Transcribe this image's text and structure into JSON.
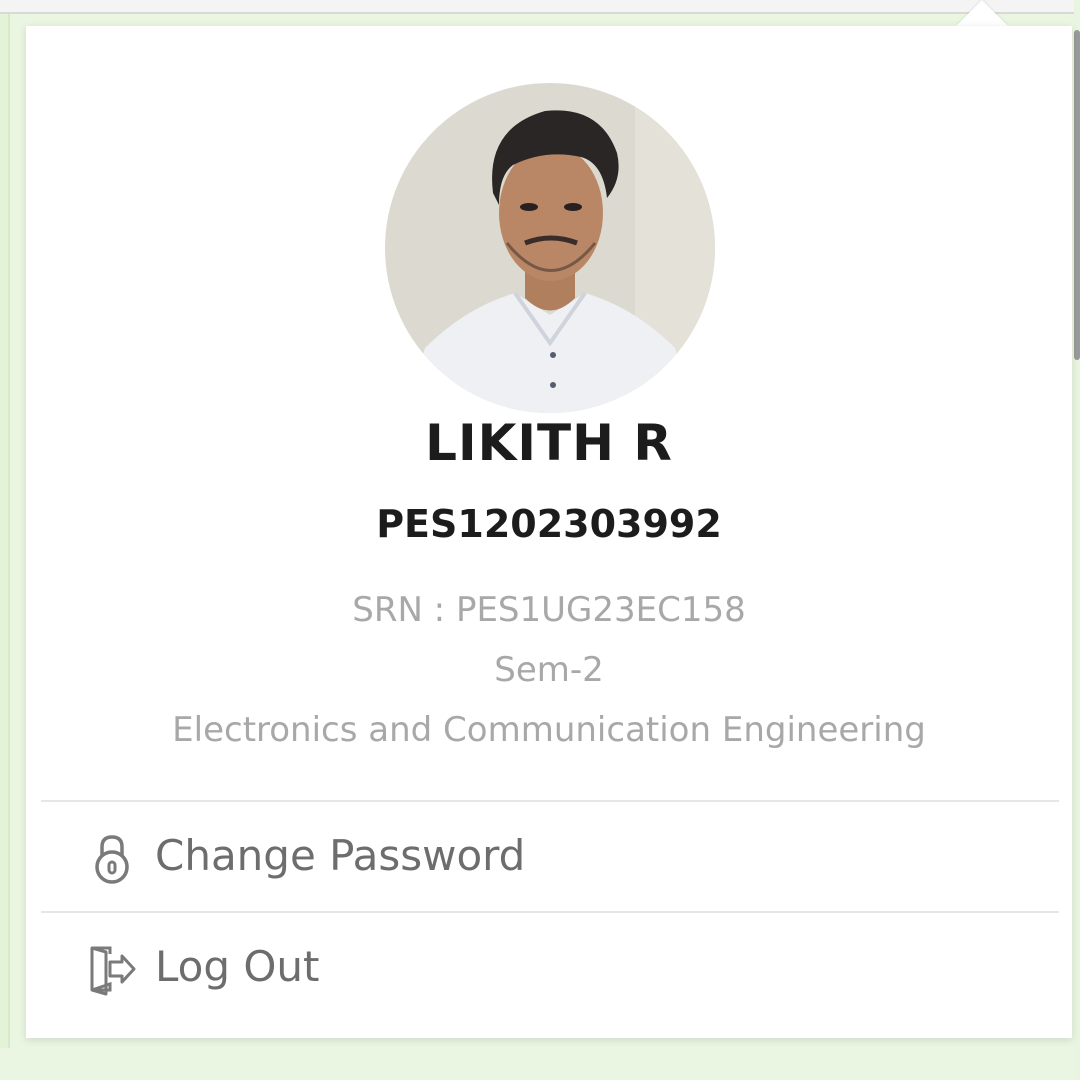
{
  "profile": {
    "name": "LIKITH R",
    "prn": "PES1202303992",
    "srn": "SRN : PES1UG23EC158",
    "semester": "Sem-2",
    "department": "Electronics and Communication Engineering"
  },
  "menu": {
    "change_password": {
      "label": "Change Password",
      "icon": "lock-icon"
    },
    "log_out": {
      "label": "Log Out",
      "icon": "logout-icon"
    }
  },
  "colors": {
    "background": "#eaf6e1",
    "popup": "#ffffff",
    "name_text": "#1c1c1c",
    "meta_text": "#a8a8a8",
    "menu_text": "#6d6d6d"
  }
}
